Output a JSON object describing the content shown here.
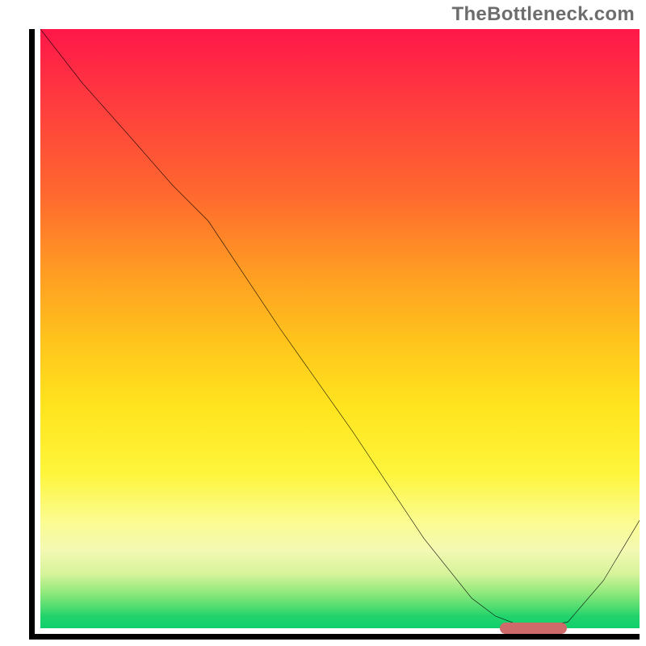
{
  "watermark": "TheBottleneck.com",
  "colors": {
    "axis": "#000000",
    "curve": "#000000",
    "pill": "#cf6a6a",
    "watermark": "#6d6d6d",
    "gradient_top": "#ff1749",
    "gradient_bottom": "#0fcf6c"
  },
  "chart_data": {
    "type": "line",
    "title": "",
    "xlabel": "",
    "ylabel": "",
    "xlim": [
      0,
      100
    ],
    "ylim": [
      0,
      100
    ],
    "grid": false,
    "x": [
      0,
      7,
      15,
      22,
      28,
      40,
      52,
      64,
      72,
      76,
      80,
      84,
      88,
      94,
      100
    ],
    "values": [
      100,
      91,
      82,
      74,
      68,
      50,
      33,
      15,
      5,
      2,
      0.5,
      0.5,
      1,
      8,
      18
    ],
    "annotations": [
      {
        "type": "pill",
        "x_start": 76,
        "x_end": 87,
        "y": 1
      }
    ]
  }
}
